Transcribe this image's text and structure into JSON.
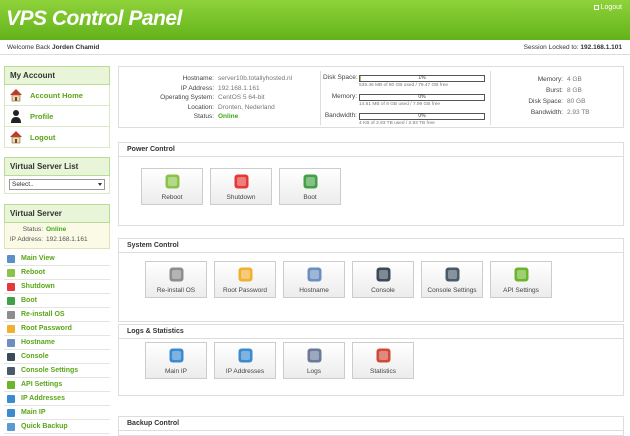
{
  "header": {
    "brand": "VPS Control Panel",
    "logout": "Logout"
  },
  "subbar": {
    "welcome_prefix": "Welcome Back",
    "user": "Jorden Chamid",
    "session_prefix": "Session Locked to:",
    "session_ip": "192.168.1.101"
  },
  "sidebar": {
    "account_title": "My Account",
    "account_items": [
      {
        "label": "Account Home",
        "icon": "house-icon"
      },
      {
        "label": "Profile",
        "icon": "user-icon"
      },
      {
        "label": "Logout",
        "icon": "house-logout-icon"
      }
    ],
    "vsl_title": "Virtual Server List",
    "select_value": "Select..",
    "vs_title": "Virtual Server",
    "vs_status_label": "Status:",
    "vs_status_value": "Online",
    "vs_ip_label": "IP Address:",
    "vs_ip_value": "192.168.1.161",
    "menu": [
      {
        "label": "Main View",
        "color": "#5b8fc8"
      },
      {
        "label": "Reboot",
        "color": "#8bc34a"
      },
      {
        "label": "Shutdown",
        "color": "#e53935"
      },
      {
        "label": "Boot",
        "color": "#43a047"
      },
      {
        "label": "Re-install OS",
        "color": "#8d8d8d"
      },
      {
        "label": "Root Password",
        "color": "#f0b030"
      },
      {
        "label": "Hostname",
        "color": "#6a8fc0"
      },
      {
        "label": "Console",
        "color": "#3a4a5a"
      },
      {
        "label": "Console Settings",
        "color": "#4a5a6a"
      },
      {
        "label": "API Settings",
        "color": "#6ab52a"
      },
      {
        "label": "IP Addresses",
        "color": "#3a8bd0"
      },
      {
        "label": "Main IP",
        "color": "#3a8bd0"
      },
      {
        "label": "Quick Backup",
        "color": "#5a9ad0"
      }
    ]
  },
  "info": {
    "left": [
      {
        "k": "Hostname:",
        "v": "server10b.totallyhosted.nl",
        "status": false
      },
      {
        "k": "IP Address:",
        "v": "192.168.1.161",
        "status": false
      },
      {
        "k": "Operating System:",
        "v": "CentOS 5 64-bit",
        "status": false
      },
      {
        "k": "Location:",
        "v": "Dronten, Nederland",
        "status": false
      },
      {
        "k": "Status:",
        "v": "Online",
        "status": true
      }
    ],
    "bars": [
      {
        "k": "Disk Space:",
        "pct": "1%",
        "frac": 0.01,
        "sub": "539.46 MB of 80 GB used / 79.47 GB free"
      },
      {
        "k": "Memory:",
        "pct": "0%",
        "frac": 0.0,
        "sub": "14.61 MB of 8 GB used / 7.99 GB free"
      },
      {
        "k": "Bandwidth:",
        "pct": "0%",
        "frac": 0.0,
        "sub": "4 KB of 2.93 TB used / 2.93 TB free"
      }
    ],
    "right": [
      {
        "k": "Memory:",
        "v": "4 GB"
      },
      {
        "k": "Burst:",
        "v": "8 GB"
      },
      {
        "k": "Disk Space:",
        "v": "80 GB"
      },
      {
        "k": "Bandwidth:",
        "v": "2.93 TB"
      }
    ]
  },
  "sections": [
    {
      "title": "Power Control",
      "tiles": [
        {
          "label": "Reboot",
          "icon": "reboot-icon",
          "color": "#8bc34a"
        },
        {
          "label": "Shutdown",
          "icon": "shutdown-icon",
          "color": "#e53935"
        },
        {
          "label": "Boot",
          "icon": "boot-icon",
          "color": "#43a047"
        }
      ]
    },
    {
      "title": "System Control",
      "tiles": [
        {
          "label": "Re-install OS",
          "icon": "reinstall-icon",
          "color": "#8d8d8d"
        },
        {
          "label": "Root Password",
          "icon": "password-icon",
          "color": "#f0b030"
        },
        {
          "label": "Hostname",
          "icon": "hostname-icon",
          "color": "#6a8fc0"
        },
        {
          "label": "Console",
          "icon": "console-icon",
          "color": "#3a4a5a"
        },
        {
          "label": "Console Settings",
          "icon": "console-settings-icon",
          "color": "#4a5a6a"
        },
        {
          "label": "API Settings",
          "icon": "api-settings-icon",
          "color": "#6ab52a"
        }
      ]
    },
    {
      "title": "Logs & Statistics",
      "tiles": [
        {
          "label": "Main IP",
          "icon": "main-ip-icon",
          "color": "#3a8bd0"
        },
        {
          "label": "IP Addresses",
          "icon": "ip-addresses-icon",
          "color": "#3a8bd0"
        },
        {
          "label": "Logs",
          "icon": "logs-icon",
          "color": "#6a7a9a"
        },
        {
          "label": "Statistics",
          "icon": "statistics-icon",
          "color": "#d04a3a"
        }
      ]
    },
    {
      "title": "Backup Control",
      "tiles": []
    }
  ]
}
